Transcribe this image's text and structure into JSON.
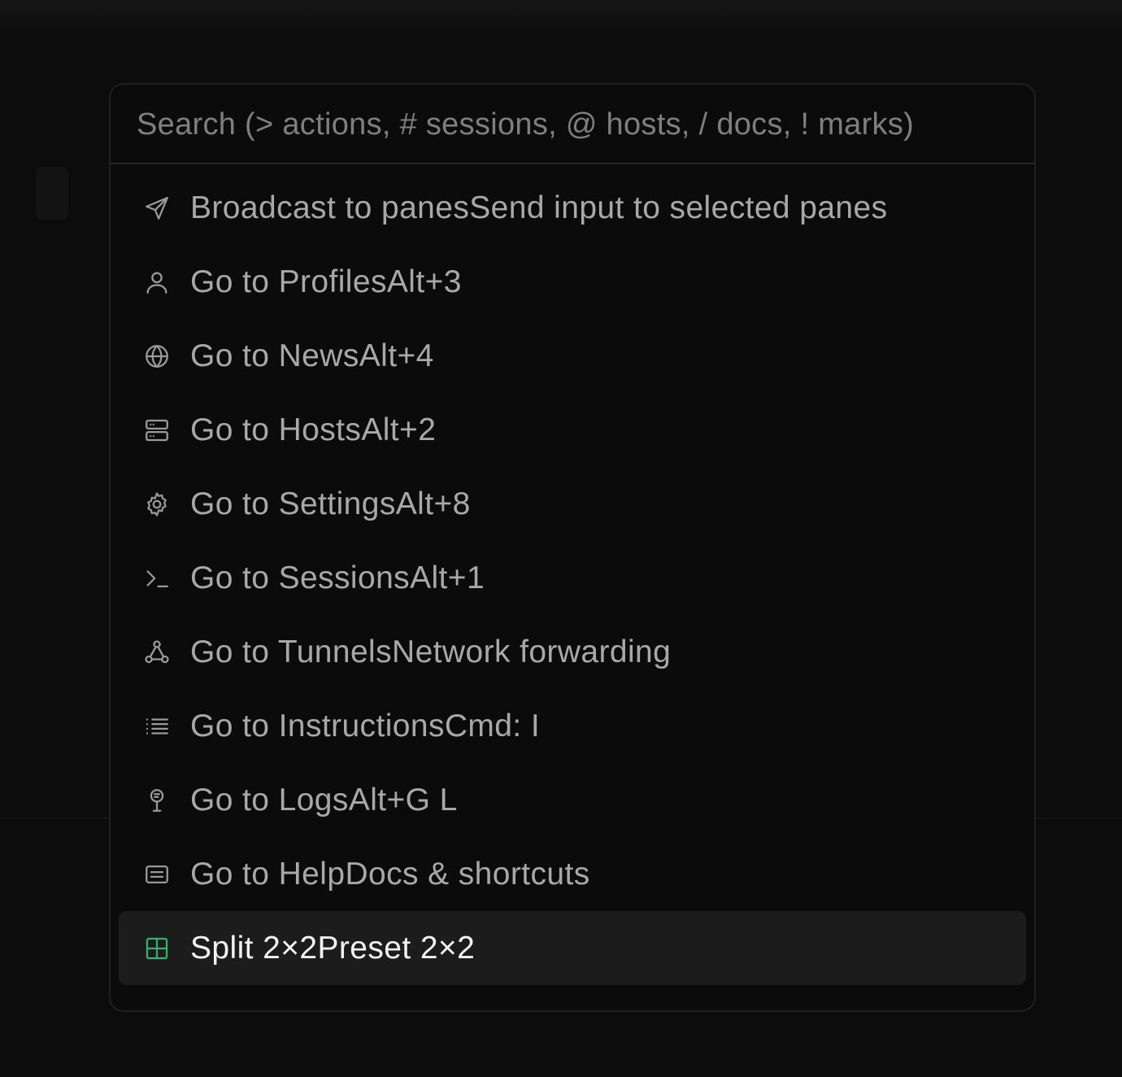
{
  "search": {
    "placeholder": "Search (> actions, # sessions, @ hosts, / docs, ! marks)",
    "value": ""
  },
  "items": [
    {
      "title": "Broadcast to panes",
      "detail": "Send input to selected panes",
      "icon": "send-icon"
    },
    {
      "title": "Go to Profiles",
      "detail": "Alt+3",
      "icon": "user-icon"
    },
    {
      "title": "Go to News",
      "detail": "Alt+4",
      "icon": "globe-icon"
    },
    {
      "title": "Go to Hosts",
      "detail": "Alt+2",
      "icon": "server-icon"
    },
    {
      "title": "Go to Settings",
      "detail": "Alt+8",
      "icon": "gear-icon"
    },
    {
      "title": "Go to Sessions",
      "detail": "Alt+1",
      "icon": "terminal-icon"
    },
    {
      "title": "Go to Tunnels",
      "detail": "Network forwarding",
      "icon": "network-icon"
    },
    {
      "title": "Go to Instructions",
      "detail": "Cmd: I",
      "icon": "list-icon"
    },
    {
      "title": "Go to Logs",
      "detail": "Alt+G L",
      "icon": "logs-icon"
    },
    {
      "title": "Go to Help",
      "detail": "Docs & shortcuts",
      "icon": "help-doc-icon"
    },
    {
      "title": "Split 2×2",
      "detail": "Preset 2×2",
      "icon": "grid-icon",
      "selected": true
    }
  ],
  "colors": {
    "accent": "#37b06a",
    "selected_bg": "#1c1c1c",
    "text": "#a8a8a8",
    "text_selected": "#f2f2f2"
  }
}
